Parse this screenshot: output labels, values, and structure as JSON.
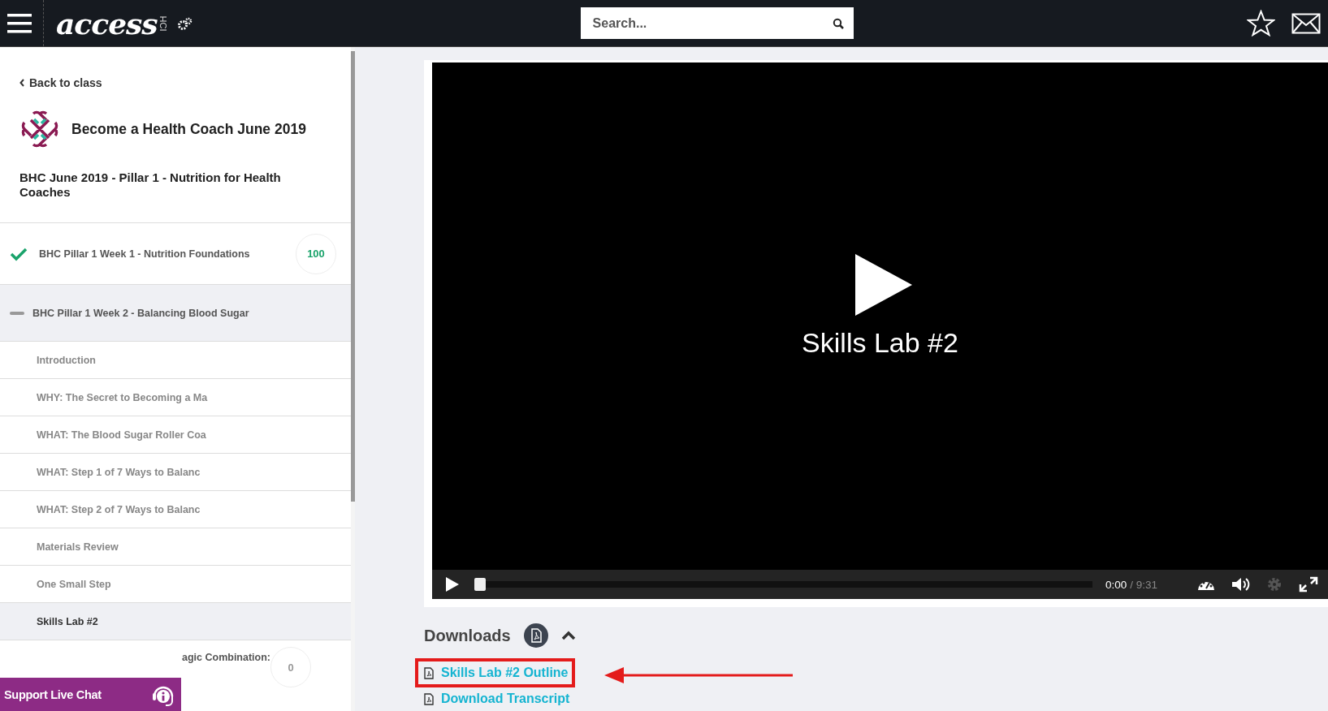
{
  "topbar": {
    "logo": "access",
    "logo_tag": "HCI",
    "search": {
      "placeholder": "Search..."
    }
  },
  "sidebar": {
    "back_link": "Back to class",
    "course_title": "Become a Health Coach June 2019",
    "section_title": "BHC June 2019 - Pillar 1 - Nutrition for Health Coaches",
    "items": [
      {
        "kind": "module",
        "label": "BHC Pillar 1 Week 1 - Nutrition Foundations",
        "completed": true,
        "expanded": false,
        "score": "100"
      },
      {
        "kind": "module",
        "label": "BHC Pillar 1 Week 2 - Balancing Blood Sugar",
        "completed": false,
        "expanded": true,
        "children": [
          {
            "label": "Introduction",
            "selected": false
          },
          {
            "label": "WHY: The Secret to Becoming a Ma",
            "selected": false
          },
          {
            "label": "WHAT: The Blood Sugar Roller Coa",
            "selected": false
          },
          {
            "label": "WHAT: Step 1 of 7 Ways to Balanc",
            "selected": false
          },
          {
            "label": "WHAT: Step 2 of 7 Ways to Balanc",
            "selected": false
          },
          {
            "label": "Materials Review",
            "selected": false
          },
          {
            "label": "One Small Step",
            "selected": false
          },
          {
            "label": "Skills Lab #2",
            "selected": true
          }
        ]
      },
      {
        "kind": "module",
        "label": "agic Combination:",
        "completed": false,
        "expanded": false,
        "score": "0"
      }
    ]
  },
  "video": {
    "title": "Skills Lab #2",
    "position": "0:00",
    "duration": "/ 9:31",
    "progress": {
      "level": 0
    },
    "settings": {
      "disabled": true
    }
  },
  "downloads": {
    "heading": "Downloads",
    "expanded": true,
    "files": [
      {
        "label": "Skills Lab #2 Outline",
        "highlighted": true
      },
      {
        "label": "Download Transcript",
        "highlighted": false
      }
    ]
  },
  "support_chat": {
    "label": "Support Live Chat"
  }
}
